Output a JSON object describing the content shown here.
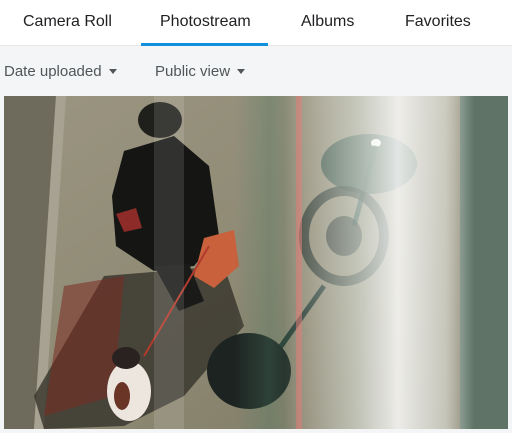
{
  "tabs": [
    {
      "label": "Camera Roll",
      "active": false
    },
    {
      "label": "Photostream",
      "active": true
    },
    {
      "label": "Albums",
      "active": false
    },
    {
      "label": "Favorites",
      "active": false
    }
  ],
  "filters": {
    "sort": {
      "selected": "Date uploaded",
      "icon": "caret-down-icon"
    },
    "view": {
      "selected": "Public view",
      "icon": "caret-down-icon"
    }
  },
  "colors": {
    "accent": "#128fdc",
    "tab_text": "#212124",
    "filter_text": "#505659",
    "background": "#f3f5f6"
  }
}
